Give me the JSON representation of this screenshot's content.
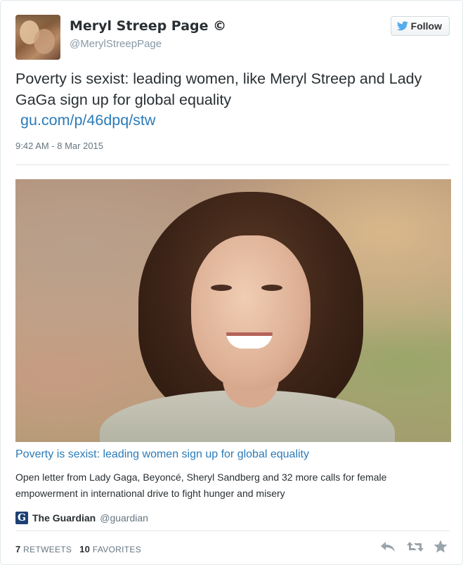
{
  "author": {
    "display_name": "Meryl Streep Page ©",
    "screen_name": "@MerylStreepPage"
  },
  "follow_button": {
    "label": "Follow"
  },
  "tweet": {
    "text": "Poverty is sexist: leading women, like Meryl Streep and Lady GaGa sign up  for global equality",
    "link": "gu.com/p/46dpq/stw",
    "timestamp": "9:42 AM - 8 Mar 2015"
  },
  "card": {
    "title": "Poverty is sexist: leading women sign up for global equality",
    "description": "Open letter from Lady Gaga, Beyoncé, Sheryl Sandberg and 32 more calls for female empowerment in international drive to fight hunger and misery",
    "source_logo": "G",
    "source_name": "The Guardian",
    "source_handle": "@guardian"
  },
  "stats": {
    "retweets_count": "7",
    "retweets_label": "RETWEETS",
    "favorites_count": "10",
    "favorites_label": "FAVORITES"
  },
  "icons": {
    "follow": "twitter-bird-icon",
    "reply": "reply-icon",
    "retweet": "retweet-icon",
    "favorite": "star-icon"
  },
  "colors": {
    "link": "#2b7bb9",
    "follow_bird": "#55acee",
    "icon_gray": "#9aa4ab",
    "guardian_blue": "#1c3f74"
  }
}
